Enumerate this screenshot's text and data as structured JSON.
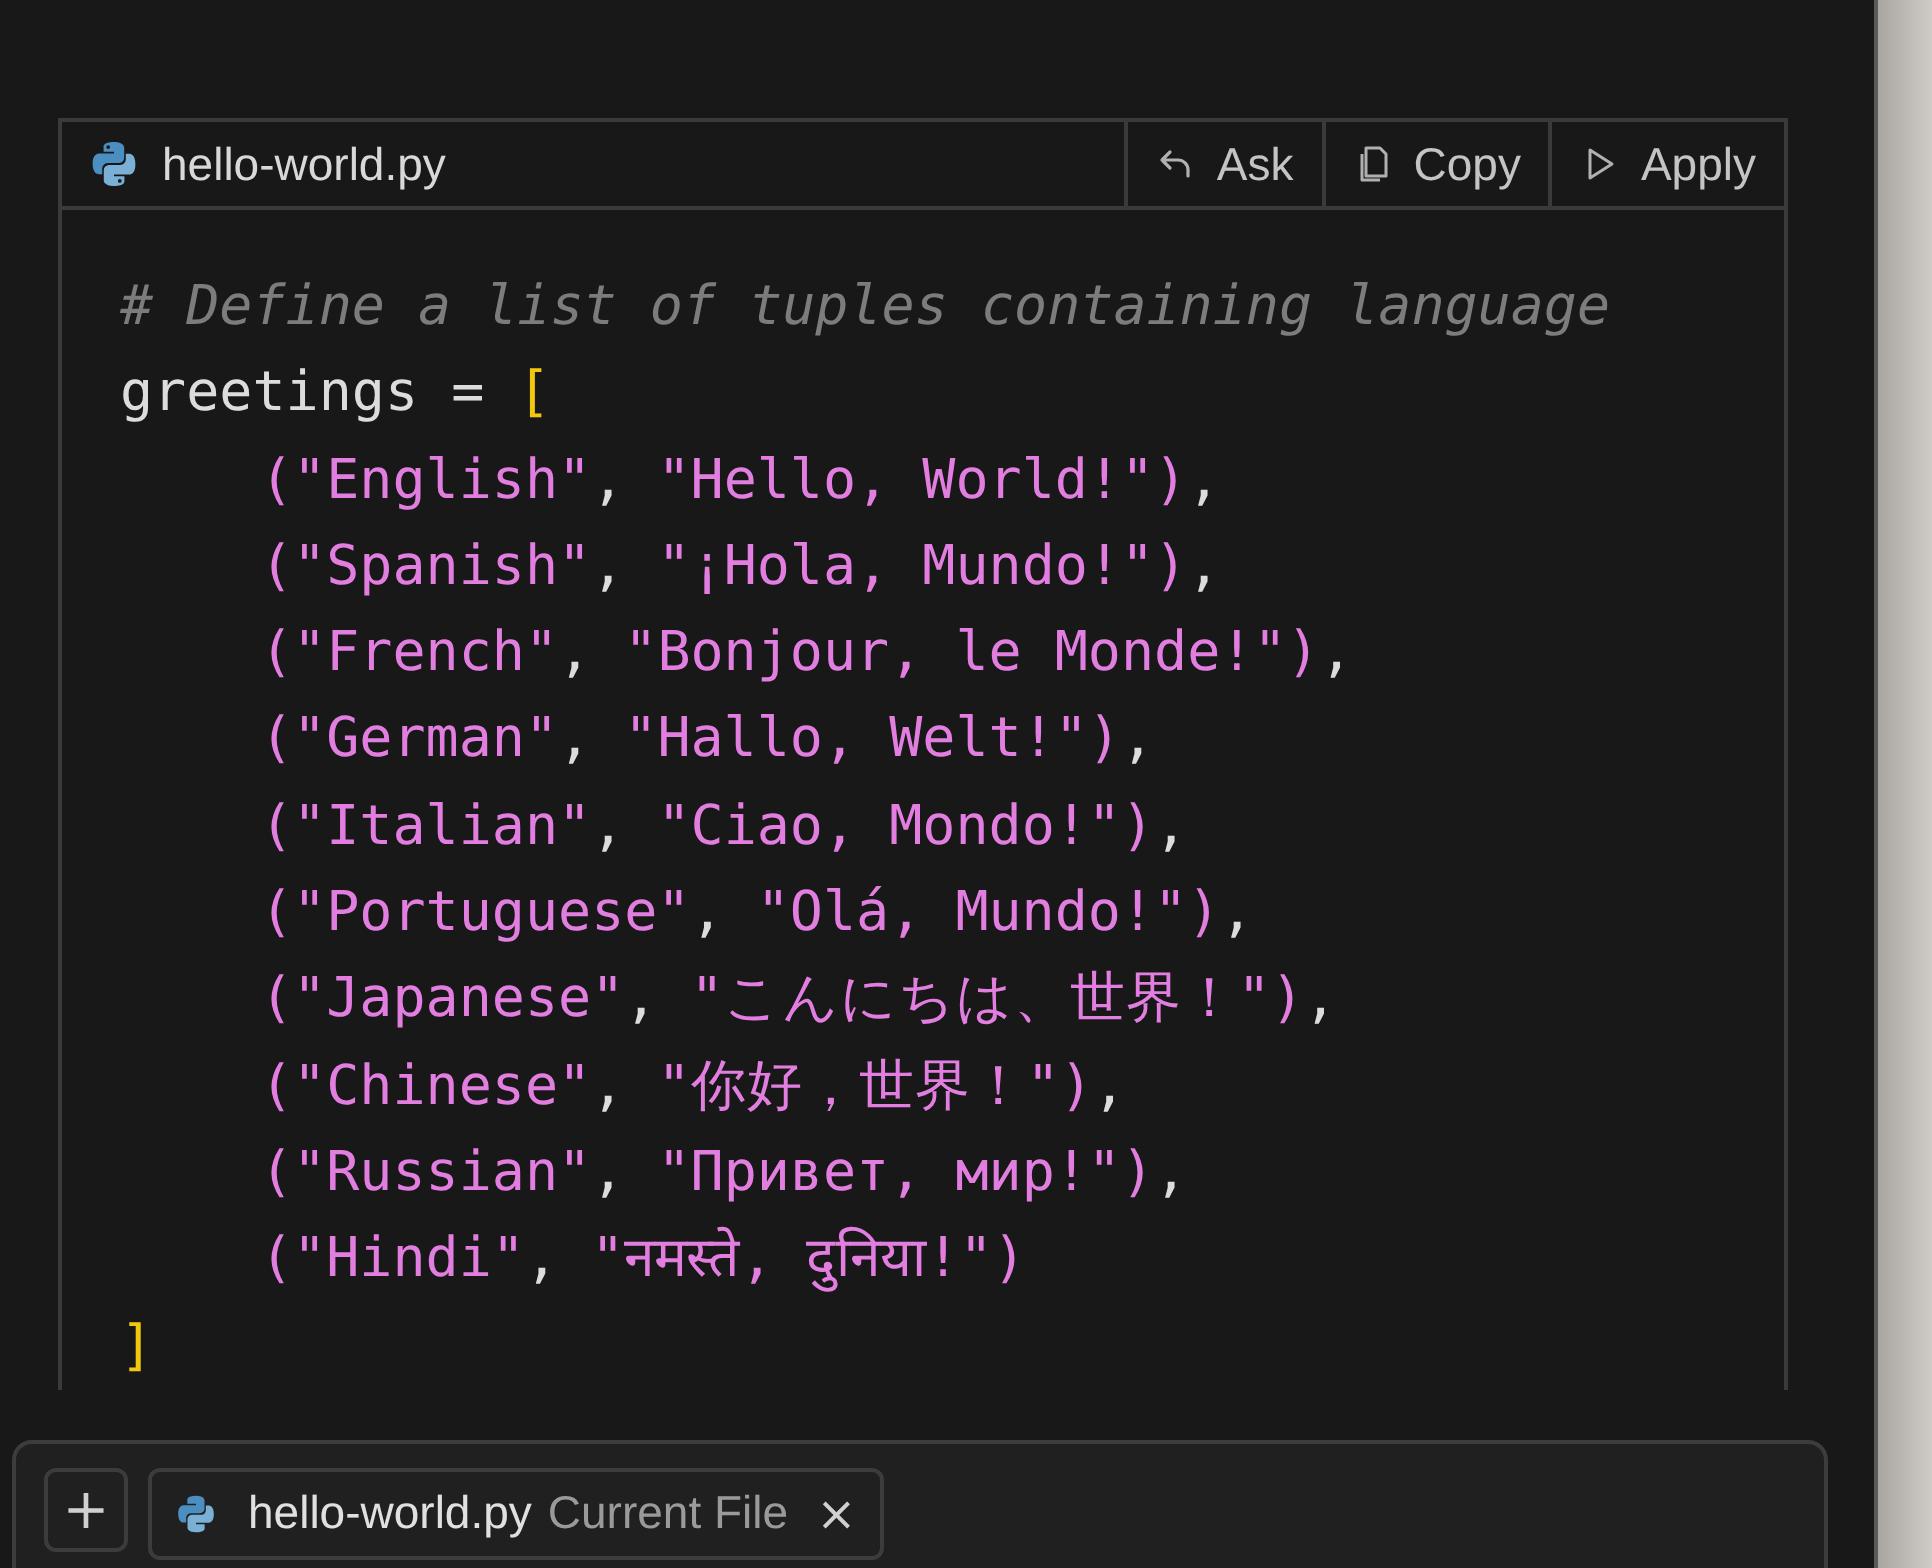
{
  "code_block": {
    "filename": "hello-world.py",
    "actions": [
      {
        "kind": "ask",
        "label": "Ask"
      },
      {
        "kind": "copy",
        "label": "Copy"
      },
      {
        "kind": "apply",
        "label": "Apply"
      }
    ],
    "lines": [
      {
        "kind": "top",
        "tokens": [
          {
            "kind": "comment",
            "text": "# Define a list of tuples containing language"
          }
        ]
      },
      {
        "kind": "top",
        "tokens": [
          {
            "kind": "plain",
            "text": "greetings = "
          },
          {
            "kind": "bracket",
            "text": "["
          }
        ]
      },
      {
        "kind": "item",
        "tokens": [
          {
            "kind": "string",
            "text": "(\"English\""
          },
          {
            "kind": "plain",
            "text": ", "
          },
          {
            "kind": "string",
            "text": "\"Hello, World!\")"
          },
          {
            "kind": "plain",
            "text": ","
          }
        ]
      },
      {
        "kind": "item",
        "tokens": [
          {
            "kind": "string",
            "text": "(\"Spanish\""
          },
          {
            "kind": "plain",
            "text": ", "
          },
          {
            "kind": "string",
            "text": "\"¡Hola, Mundo!\")"
          },
          {
            "kind": "plain",
            "text": ","
          }
        ]
      },
      {
        "kind": "item",
        "tokens": [
          {
            "kind": "string",
            "text": "(\"French\""
          },
          {
            "kind": "plain",
            "text": ", "
          },
          {
            "kind": "string",
            "text": "\"Bonjour, le Monde!\")"
          },
          {
            "kind": "plain",
            "text": ","
          }
        ]
      },
      {
        "kind": "item",
        "tokens": [
          {
            "kind": "string",
            "text": "(\"German\""
          },
          {
            "kind": "plain",
            "text": ", "
          },
          {
            "kind": "string",
            "text": "\"Hallo, Welt!\")"
          },
          {
            "kind": "plain",
            "text": ","
          }
        ]
      },
      {
        "kind": "item",
        "tokens": [
          {
            "kind": "string",
            "text": "(\"Italian\""
          },
          {
            "kind": "plain",
            "text": ", "
          },
          {
            "kind": "string",
            "text": "\"Ciao, Mondo!\")"
          },
          {
            "kind": "plain",
            "text": ","
          }
        ]
      },
      {
        "kind": "item",
        "tokens": [
          {
            "kind": "string",
            "text": "(\"Portuguese\""
          },
          {
            "kind": "plain",
            "text": ", "
          },
          {
            "kind": "string",
            "text": "\"Olá, Mundo!\")"
          },
          {
            "kind": "plain",
            "text": ","
          }
        ]
      },
      {
        "kind": "item",
        "tokens": [
          {
            "kind": "string",
            "text": "(\"Japanese\""
          },
          {
            "kind": "plain",
            "text": ", "
          },
          {
            "kind": "string",
            "text": "\"こんにちは、世界！\")"
          },
          {
            "kind": "plain",
            "text": ","
          }
        ]
      },
      {
        "kind": "item",
        "tokens": [
          {
            "kind": "string",
            "text": "(\"Chinese\""
          },
          {
            "kind": "plain",
            "text": ", "
          },
          {
            "kind": "string",
            "text": "\"你好，世界！\")"
          },
          {
            "kind": "plain",
            "text": ","
          }
        ]
      },
      {
        "kind": "item",
        "tokens": [
          {
            "kind": "string",
            "text": "(\"Russian\""
          },
          {
            "kind": "plain",
            "text": ", "
          },
          {
            "kind": "string",
            "text": "\"Привет, мир!\")"
          },
          {
            "kind": "plain",
            "text": ","
          }
        ]
      },
      {
        "kind": "item",
        "tokens": [
          {
            "kind": "string",
            "text": "(\"Hindi\""
          },
          {
            "kind": "plain",
            "text": ", "
          },
          {
            "kind": "string",
            "text": "\"नमस्ते, दुनिया!\")"
          }
        ]
      },
      {
        "kind": "top",
        "tokens": [
          {
            "kind": "bracket",
            "text": "]"
          }
        ]
      }
    ]
  },
  "composer": {
    "add_label": "+",
    "file_chip": {
      "name": "hello-world.py",
      "tag": "Current File",
      "close": "×"
    }
  }
}
